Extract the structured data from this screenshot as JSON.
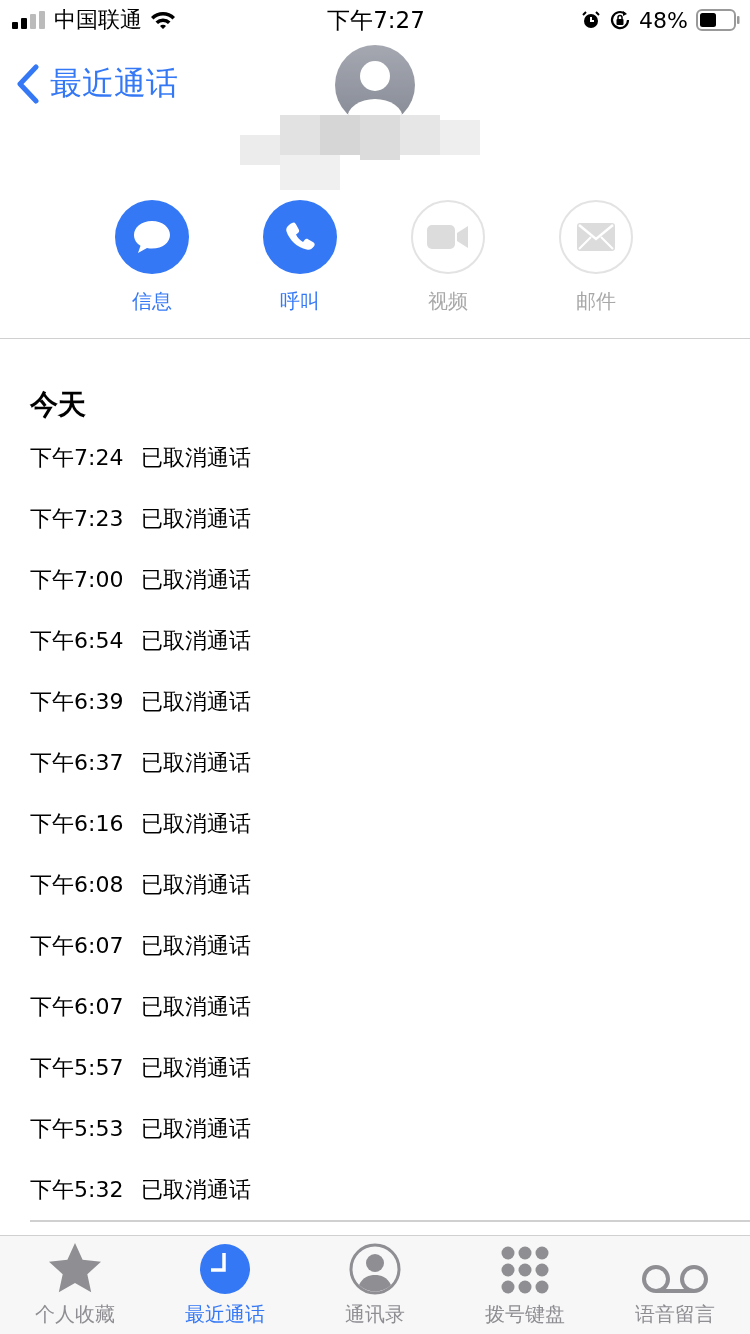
{
  "status_bar": {
    "carrier": "中国联通",
    "time": "下午7:27",
    "battery": "48%"
  },
  "nav": {
    "back": "最近通话"
  },
  "actions": [
    {
      "kind": "message",
      "label": "信息",
      "disabled": false
    },
    {
      "kind": "call",
      "label": "呼叫",
      "disabled": false
    },
    {
      "kind": "video",
      "label": "视频",
      "disabled": true
    },
    {
      "kind": "mail",
      "label": "邮件",
      "disabled": true
    }
  ],
  "history": {
    "heading": "今天",
    "calls": [
      {
        "time": "下午7:24",
        "status": "已取消通话"
      },
      {
        "time": "下午7:23",
        "status": "已取消通话"
      },
      {
        "time": "下午7:00",
        "status": "已取消通话"
      },
      {
        "time": "下午6:54",
        "status": "已取消通话"
      },
      {
        "time": "下午6:39",
        "status": "已取消通话"
      },
      {
        "time": "下午6:37",
        "status": "已取消通话"
      },
      {
        "time": "下午6:16",
        "status": "已取消通话"
      },
      {
        "time": "下午6:08",
        "status": "已取消通话"
      },
      {
        "time": "下午6:07",
        "status": "已取消通话"
      },
      {
        "time": "下午6:07",
        "status": "已取消通话"
      },
      {
        "time": "下午5:57",
        "status": "已取消通话"
      },
      {
        "time": "下午5:53",
        "status": "已取消通话"
      },
      {
        "time": "下午5:32",
        "status": "已取消通话"
      }
    ]
  },
  "tab_bar": [
    {
      "kind": "favorites",
      "label": "个人收藏",
      "selected": false
    },
    {
      "kind": "recents",
      "label": "最近通话",
      "selected": true
    },
    {
      "kind": "contacts",
      "label": "通讯录",
      "selected": false
    },
    {
      "kind": "keypad",
      "label": "拨号键盘",
      "selected": false
    },
    {
      "kind": "voicemail",
      "label": "语音留言",
      "selected": false
    }
  ]
}
